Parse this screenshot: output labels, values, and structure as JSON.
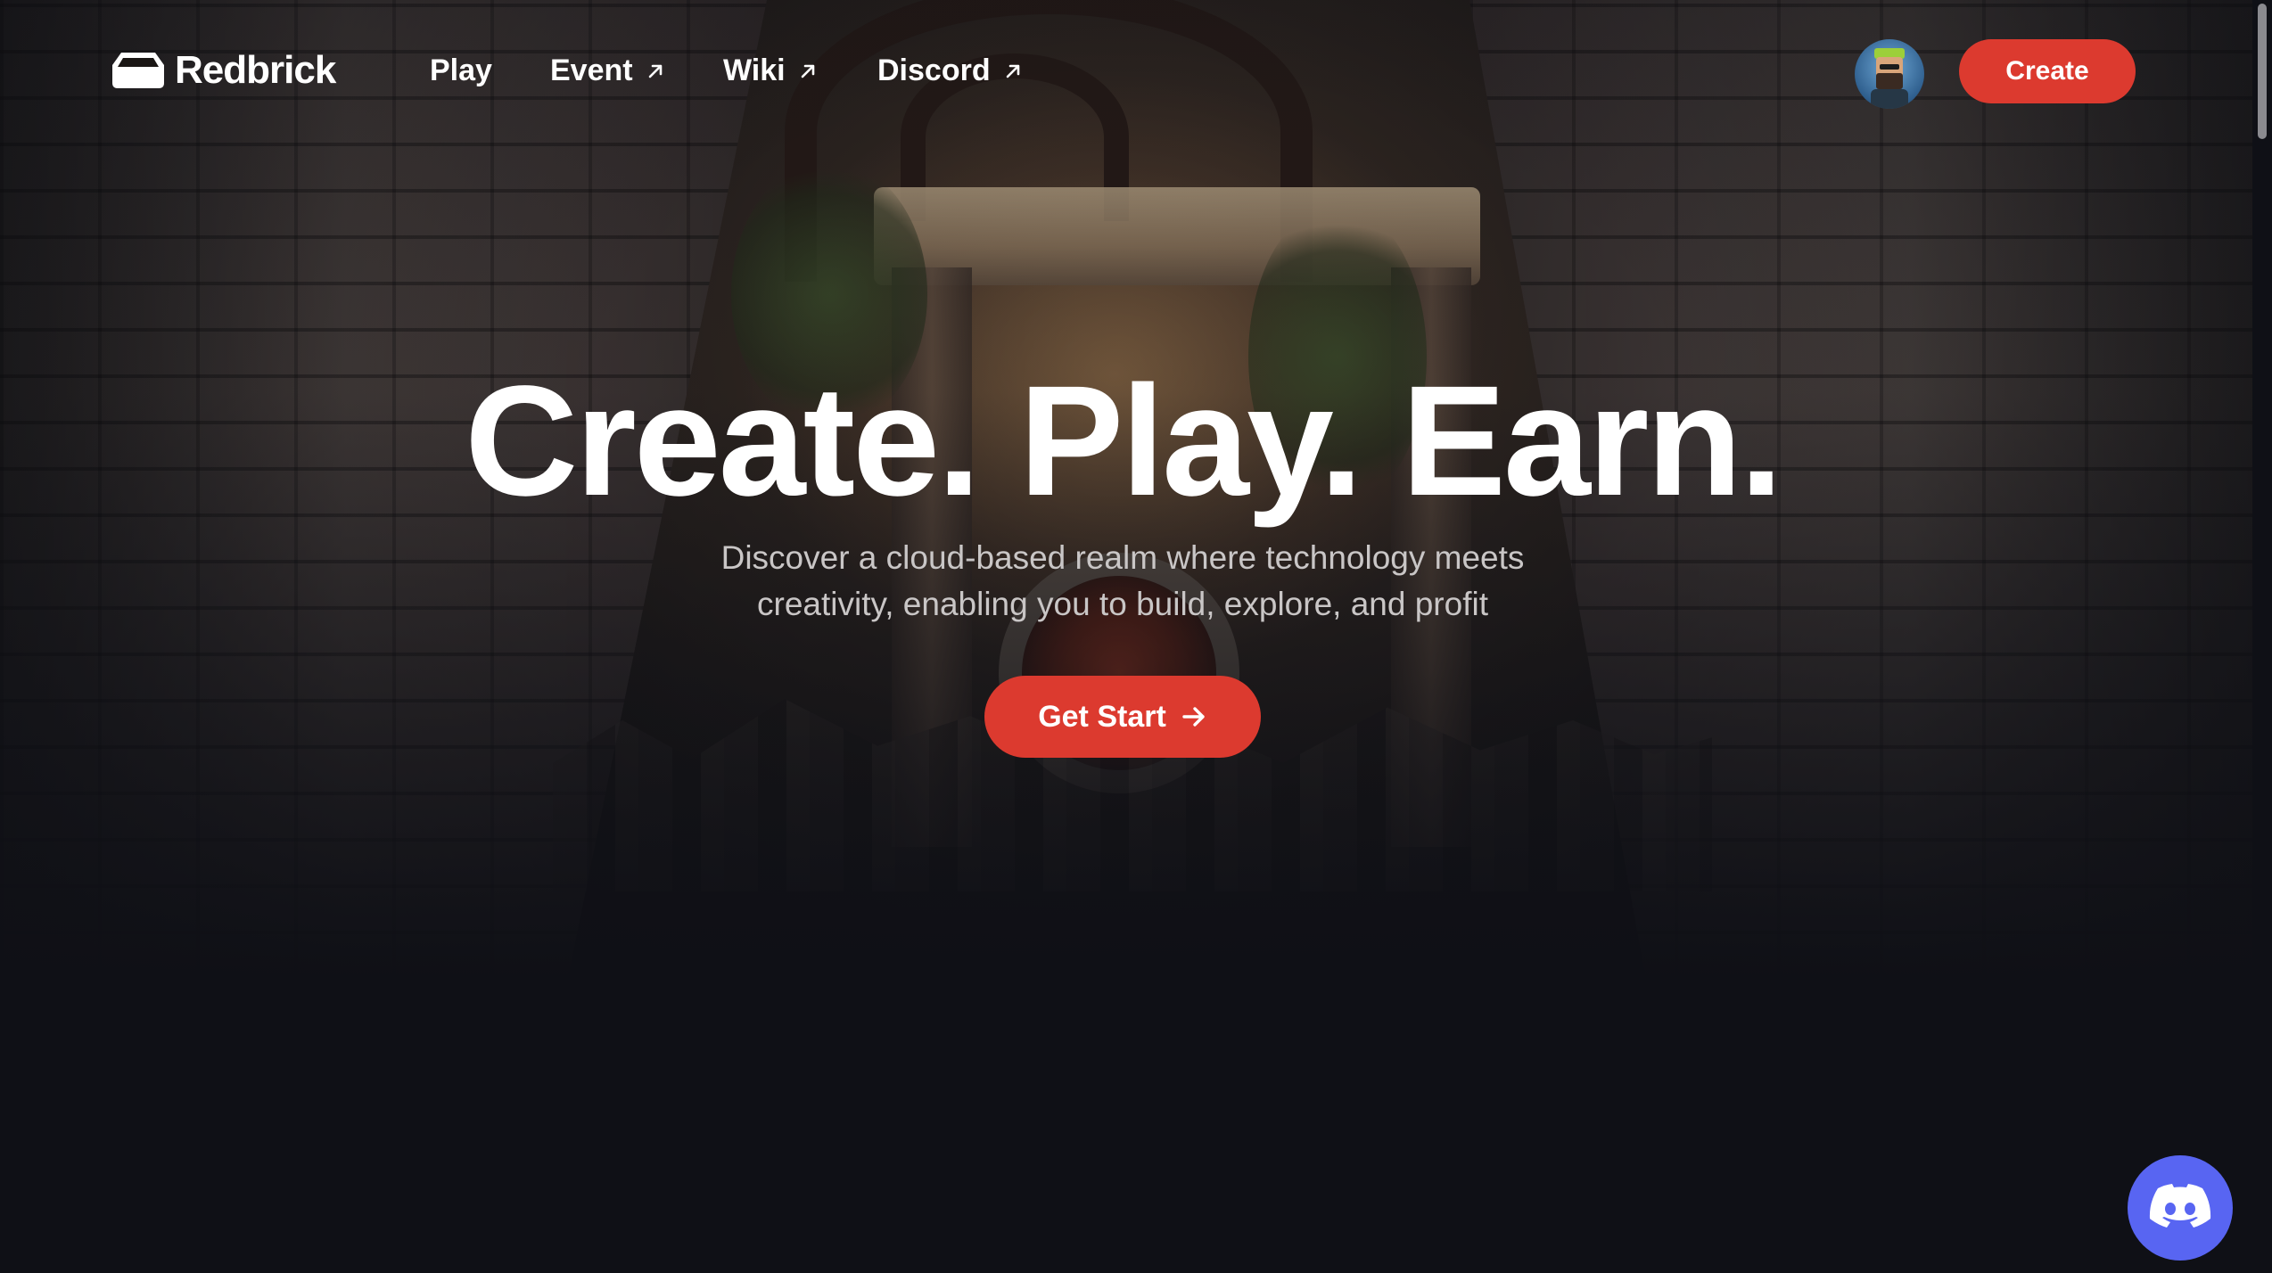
{
  "nav": {
    "logo": {
      "text": "Redbrick",
      "icon": "redbrick-logo-icon"
    },
    "links": [
      {
        "label": "Play",
        "external": false
      },
      {
        "label": "Event",
        "external": true,
        "icon": "external-arrow-icon"
      },
      {
        "label": "Wiki",
        "external": true,
        "icon": "external-arrow-icon"
      },
      {
        "label": "Discord",
        "external": true,
        "icon": "external-arrow-icon"
      }
    ],
    "avatar": {
      "icon": "user-avatar"
    },
    "create_label": "Create"
  },
  "hero": {
    "title": "Create. Play. Earn.",
    "subtitle_line1": "Discover a cloud-based realm where technology meets",
    "subtitle_line2": "creativity, enabling you to build, explore, and profit",
    "cta_label": "Get Start",
    "cta_icon": "arrow-right-icon"
  },
  "floating": {
    "icon": "discord-icon"
  },
  "colors": {
    "accent": "#dc3a2f",
    "background": "#0f1016",
    "discord": "#5865f2",
    "text": "#ffffff",
    "subtext": "#c9c6c6"
  }
}
